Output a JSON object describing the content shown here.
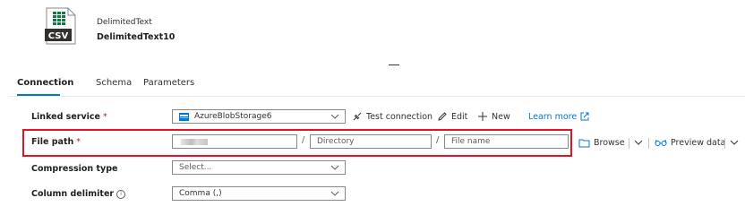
{
  "header": {
    "icon_label": "CSV",
    "dataset_type": "DelimitedText",
    "dataset_name": "DelimitedText10"
  },
  "tabs": [
    {
      "label": "Connection",
      "active": true
    },
    {
      "label": "Schema",
      "active": false
    },
    {
      "label": "Parameters",
      "active": false
    }
  ],
  "form": {
    "linked_service": {
      "label": "Linked service",
      "required_mark": "*",
      "value": "AzureBlobStorage6",
      "test_connection": "Test connection",
      "edit": "Edit",
      "new": "New",
      "learn_more": "Learn more"
    },
    "file_path": {
      "label": "File path",
      "required_mark": "*",
      "separator": "/",
      "directory_placeholder": "Directory",
      "file_name_placeholder": "File name",
      "browse": "Browse",
      "preview_data": "Preview data"
    },
    "compression_type": {
      "label": "Compression type",
      "placeholder": "Select..."
    },
    "column_delimiter": {
      "label": "Column delimiter",
      "info_symbol": "i",
      "value": "Comma (,)"
    }
  },
  "colors": {
    "accent": "#0078d4",
    "highlight_box": "#e81123",
    "required": "#a4262c",
    "csv_green": "#107c41"
  }
}
